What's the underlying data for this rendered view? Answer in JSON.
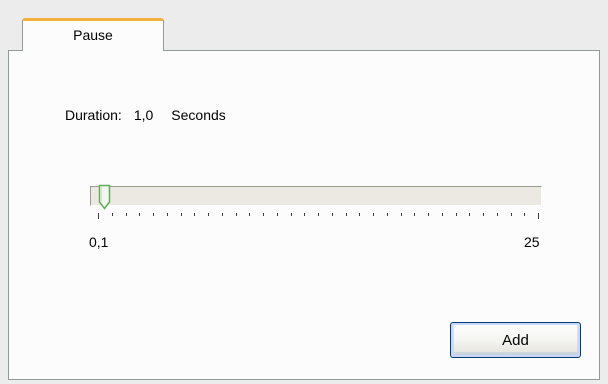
{
  "tab": {
    "label": "Pause"
  },
  "duration": {
    "label": "Duration:",
    "value": "1,0",
    "unit": "Seconds"
  },
  "slider": {
    "min_label": "0,1",
    "max_label": "25",
    "min": 0.1,
    "max": 25,
    "value": 1.0,
    "tick_count": 33
  },
  "buttons": {
    "add_label": "Add"
  },
  "colors": {
    "tab_accent": "#f3b13c",
    "thumb_green": "#5fae5a",
    "button_border": "#003c74"
  },
  "icons": {
    "thumb": "slider-thumb-icon"
  }
}
